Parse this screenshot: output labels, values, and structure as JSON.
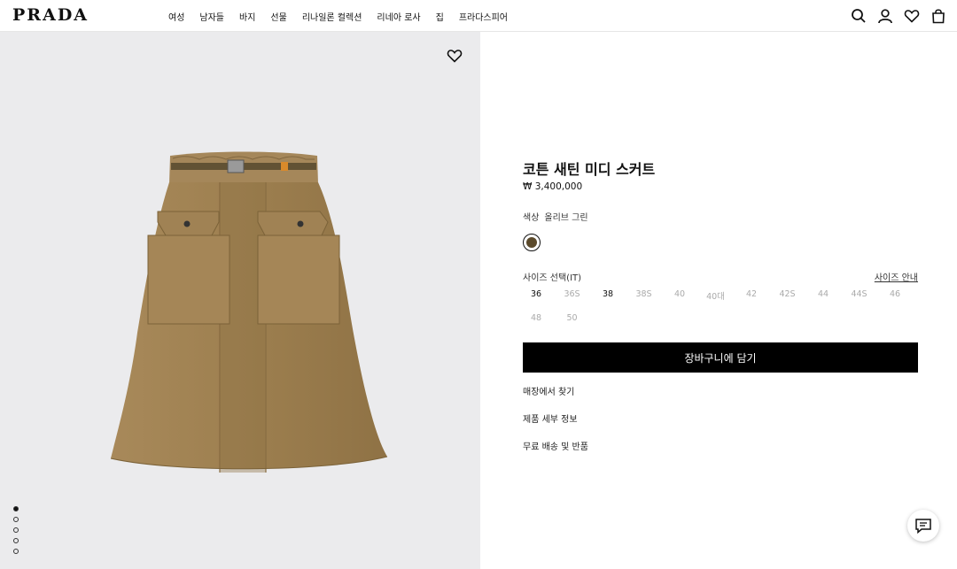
{
  "header": {
    "logo": "PRADA",
    "nav": [
      "여성",
      "남자들",
      "바지",
      "선물",
      "리나일론 컬렉션",
      "리네아 로사",
      "집",
      "프라다스피어"
    ],
    "icons": [
      "search-icon",
      "account-icon",
      "wishlist-icon",
      "bag-icon"
    ]
  },
  "gallery": {
    "favorite_icon": "heart-icon",
    "product_color": "#9a7b4f",
    "dots": [
      true,
      false,
      false,
      false,
      false
    ]
  },
  "product": {
    "title": "코튼 새틴 미디 스커트",
    "price": "₩ 3,400,000",
    "color_label": "색상",
    "color_name": "올리브 그린",
    "swatch_color": "#5b4a2c",
    "size_label": "사이즈 선택(IT)",
    "size_guide": "사이즈 안내",
    "sizes": [
      {
        "label": "36",
        "available": true
      },
      {
        "label": "36S",
        "available": false
      },
      {
        "label": "38",
        "available": true
      },
      {
        "label": "38S",
        "available": false
      },
      {
        "label": "40",
        "available": false
      },
      {
        "label": "40대",
        "available": false
      },
      {
        "label": "42",
        "available": false
      },
      {
        "label": "42S",
        "available": false
      },
      {
        "label": "44",
        "available": false
      },
      {
        "label": "44S",
        "available": false
      },
      {
        "label": "46",
        "available": false
      },
      {
        "label": "48",
        "available": false
      },
      {
        "label": "50",
        "available": false
      }
    ],
    "add_to_cart": "장바구니에 담기",
    "links": [
      "매장에서 찾기",
      "제품 세부 정보",
      "무료 배송 및 반품"
    ]
  },
  "chat_icon": "chat-icon"
}
